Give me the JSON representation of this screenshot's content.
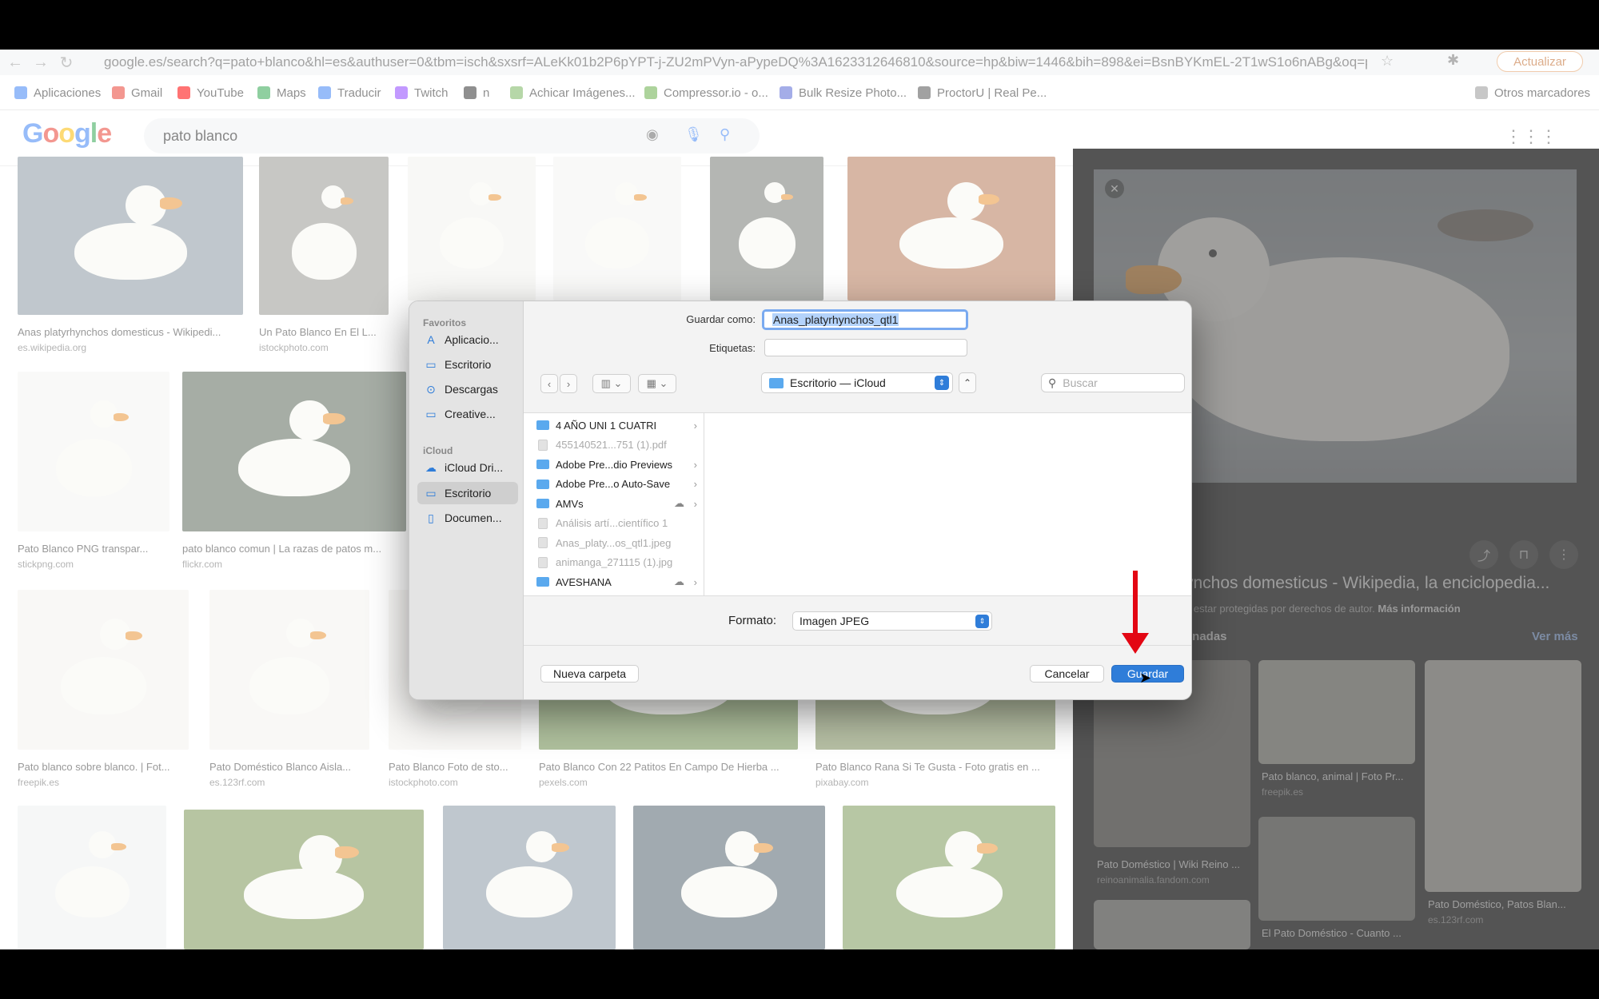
{
  "browser": {
    "url": "google.es/search?q=pato+blanco&hl=es&authuser=0&tbm=isch&sxsrf=ALeKk01b2P6pYPT-j-ZU2mPVyn-aPypeDQ%3A1623312646810&source=hp&biw=1446&bih=898&ei=BsnBYKmEL-2T1wS1o6nABg&oq=p...",
    "update_label": "Actualizar",
    "bookmarks": [
      "Aplicaciones",
      "Gmail",
      "YouTube",
      "Maps",
      "Traducir",
      "Twitch",
      "n",
      "Achicar Imágenes...",
      "Compressor.io - o...",
      "Bulk Resize Photo...",
      "ProctorU | Real Pe..."
    ],
    "other_bookmarks": "Otros marcadores",
    "bookmark_colors": [
      "#4285f4",
      "#ea4335",
      "#ff0000",
      "#34a853",
      "#4285f4",
      "#9146ff",
      "#333333",
      "#7bb661",
      "#6ab04c",
      "#5a6bd6",
      "#555555"
    ]
  },
  "google": {
    "logo": [
      "G",
      "o",
      "o",
      "g",
      "l",
      "e"
    ],
    "query": "pato blanco"
  },
  "results": [
    {
      "caption": "Anas platyrhynchos domesticus - Wikipedi...",
      "source": "es.wikipedia.org"
    },
    {
      "caption": "Un Pato Blanco En El L...",
      "source": "istockphoto.com"
    },
    {
      "caption": "Pato Blanco PNG transpar...",
      "source": "stickpng.com"
    },
    {
      "caption": "pato blanco comun | La razas de patos m...",
      "source": "flickr.com"
    },
    {
      "caption": "Pato blanco sobre blanco. | Fot...",
      "source": "freepik.es"
    },
    {
      "caption": "Pato Doméstico Blanco Aisla...",
      "source": "es.123rf.com"
    },
    {
      "caption": "Pato Blanco Foto de sto...",
      "source": "istockphoto.com"
    },
    {
      "caption": "Pato Blanco Con 22 Patitos En Campo De Hierba ...",
      "source": "pexels.com"
    },
    {
      "caption": "Pato Blanco Rana Si Te Gusta - Foto gratis en ...",
      "source": "pixabay.com"
    }
  ],
  "side_panel": {
    "title": "ynchos domesticus - Wikipedia, la enciclopedia...",
    "subtitle": "n estar protegidas por derechos de autor.",
    "more_info": "Más información",
    "related_label": "onadas",
    "see_more": "Ver más",
    "related": [
      {
        "caption": "Pato blanco, animal | Foto Pr...",
        "source": "freepik.es"
      },
      {
        "caption": "Pato Doméstico | Wiki Reino ...",
        "source": "reinoanimalia.fandom.com"
      },
      {
        "caption": "Pato Doméstico, Patos Blan...",
        "source": "es.123rf.com"
      },
      {
        "caption": "El Pato Doméstico - Cuanto ...",
        "source": ""
      }
    ]
  },
  "dialog": {
    "favorites_header": "Favoritos",
    "favorites": [
      "Aplicacio...",
      "Escritorio",
      "Descargas",
      "Creative..."
    ],
    "icloud_header": "iCloud",
    "icloud": [
      "iCloud Dri...",
      "Escritorio",
      "Documen..."
    ],
    "save_as_label": "Guardar como:",
    "save_as_value": "Anas_platyrhynchos_qtl1",
    "tags_label": "Etiquetas:",
    "location": "Escritorio — iCloud",
    "search_placeholder": "Buscar",
    "files": [
      {
        "name": "4 AÑO UNI 1 CUATRI",
        "type": "folder",
        "dim": false,
        "chevron": true,
        "cloud": false
      },
      {
        "name": "455140521...751 (1).pdf",
        "type": "file",
        "dim": true,
        "chevron": false,
        "cloud": false
      },
      {
        "name": "Adobe Pre...dio Previews",
        "type": "folder",
        "dim": false,
        "chevron": true,
        "cloud": false
      },
      {
        "name": "Adobe Pre...o Auto-Save",
        "type": "folder",
        "dim": false,
        "chevron": true,
        "cloud": false
      },
      {
        "name": "AMVs",
        "type": "folder",
        "dim": false,
        "chevron": true,
        "cloud": true
      },
      {
        "name": "Análisis artí...científico 1",
        "type": "file",
        "dim": true,
        "chevron": false,
        "cloud": false
      },
      {
        "name": "Anas_platy...os_qtl1.jpeg",
        "type": "file",
        "dim": true,
        "chevron": false,
        "cloud": false
      },
      {
        "name": "animanga_271115 (1).jpg",
        "type": "file",
        "dim": true,
        "chevron": false,
        "cloud": false
      },
      {
        "name": "AVESHANA",
        "type": "folder",
        "dim": false,
        "chevron": true,
        "cloud": true
      }
    ],
    "format_label": "Formato:",
    "format_value": "Imagen JPEG",
    "new_folder": "Nueva carpeta",
    "cancel": "Cancelar",
    "save": "Guardar"
  },
  "colors": {
    "accent": "#2f7dd9",
    "annotation": "#e30613"
  }
}
